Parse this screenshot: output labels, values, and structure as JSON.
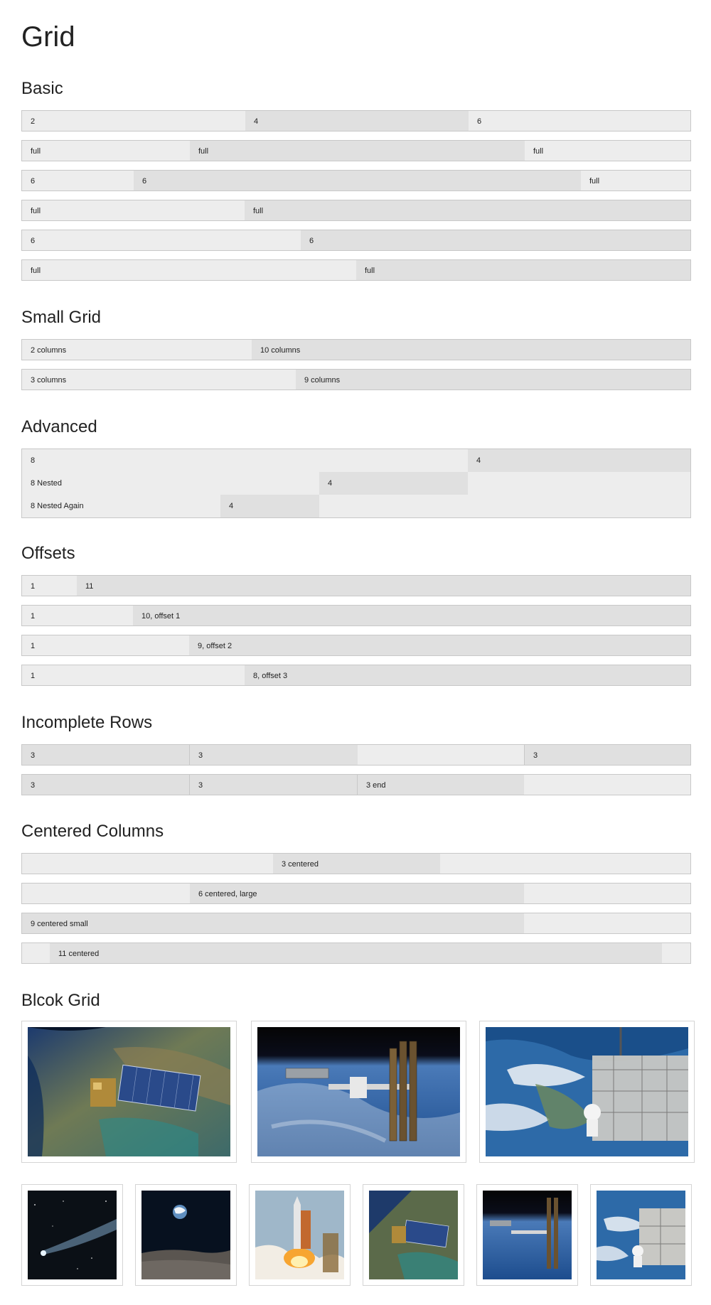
{
  "page_title": "Grid",
  "sections": {
    "basic": "Basic",
    "small_grid": "Small Grid",
    "advanced": "Advanced",
    "offsets": "Offsets",
    "incomplete_rows": "Incomplete Rows",
    "centered_columns": "Centered Columns",
    "block_grid": "Blcok Grid"
  },
  "basic": {
    "row1": [
      "2",
      "4",
      "6"
    ],
    "row2": [
      "full",
      "full",
      "full"
    ],
    "row3": [
      "6",
      "6",
      "full"
    ],
    "row4": [
      "full",
      "full"
    ],
    "row5": [
      "6",
      "6"
    ],
    "row6": [
      "full",
      "full"
    ]
  },
  "small_grid": {
    "row1": [
      "2 columns",
      "10 columns"
    ],
    "row2": [
      "3 columns",
      "9 columns"
    ]
  },
  "advanced": {
    "level1": [
      "8",
      "4"
    ],
    "level2": [
      "8 Nested",
      "4"
    ],
    "level3": [
      "8 Nested Again",
      "4"
    ]
  },
  "offsets": {
    "row1": [
      "1",
      "11"
    ],
    "row2": [
      "1",
      "10, offset 1"
    ],
    "row3": [
      "1",
      "9, offset 2"
    ],
    "row4": [
      "1",
      "8, offset 3"
    ]
  },
  "incomplete_rows": {
    "row1": [
      "3",
      "3",
      "3"
    ],
    "row2": [
      "3",
      "3",
      "3 end"
    ]
  },
  "centered_columns": {
    "row1": "3 centered",
    "row2": "6 centered, large",
    "row3": "9 centered small",
    "row4": "11 centered"
  },
  "block_grid": {
    "large_images": [
      "satellite-over-earth-image",
      "space-station-image",
      "astronaut-spacewalk-image"
    ],
    "small_images": [
      "comet-image",
      "earthrise-image",
      "shuttle-launch-image",
      "satellite-over-earth-image",
      "space-station-image",
      "astronaut-spacewalk-image"
    ]
  },
  "colors": {
    "cell_light": "#ededed",
    "cell_dark": "#e0e0e0",
    "border": "#c8c8c8"
  }
}
